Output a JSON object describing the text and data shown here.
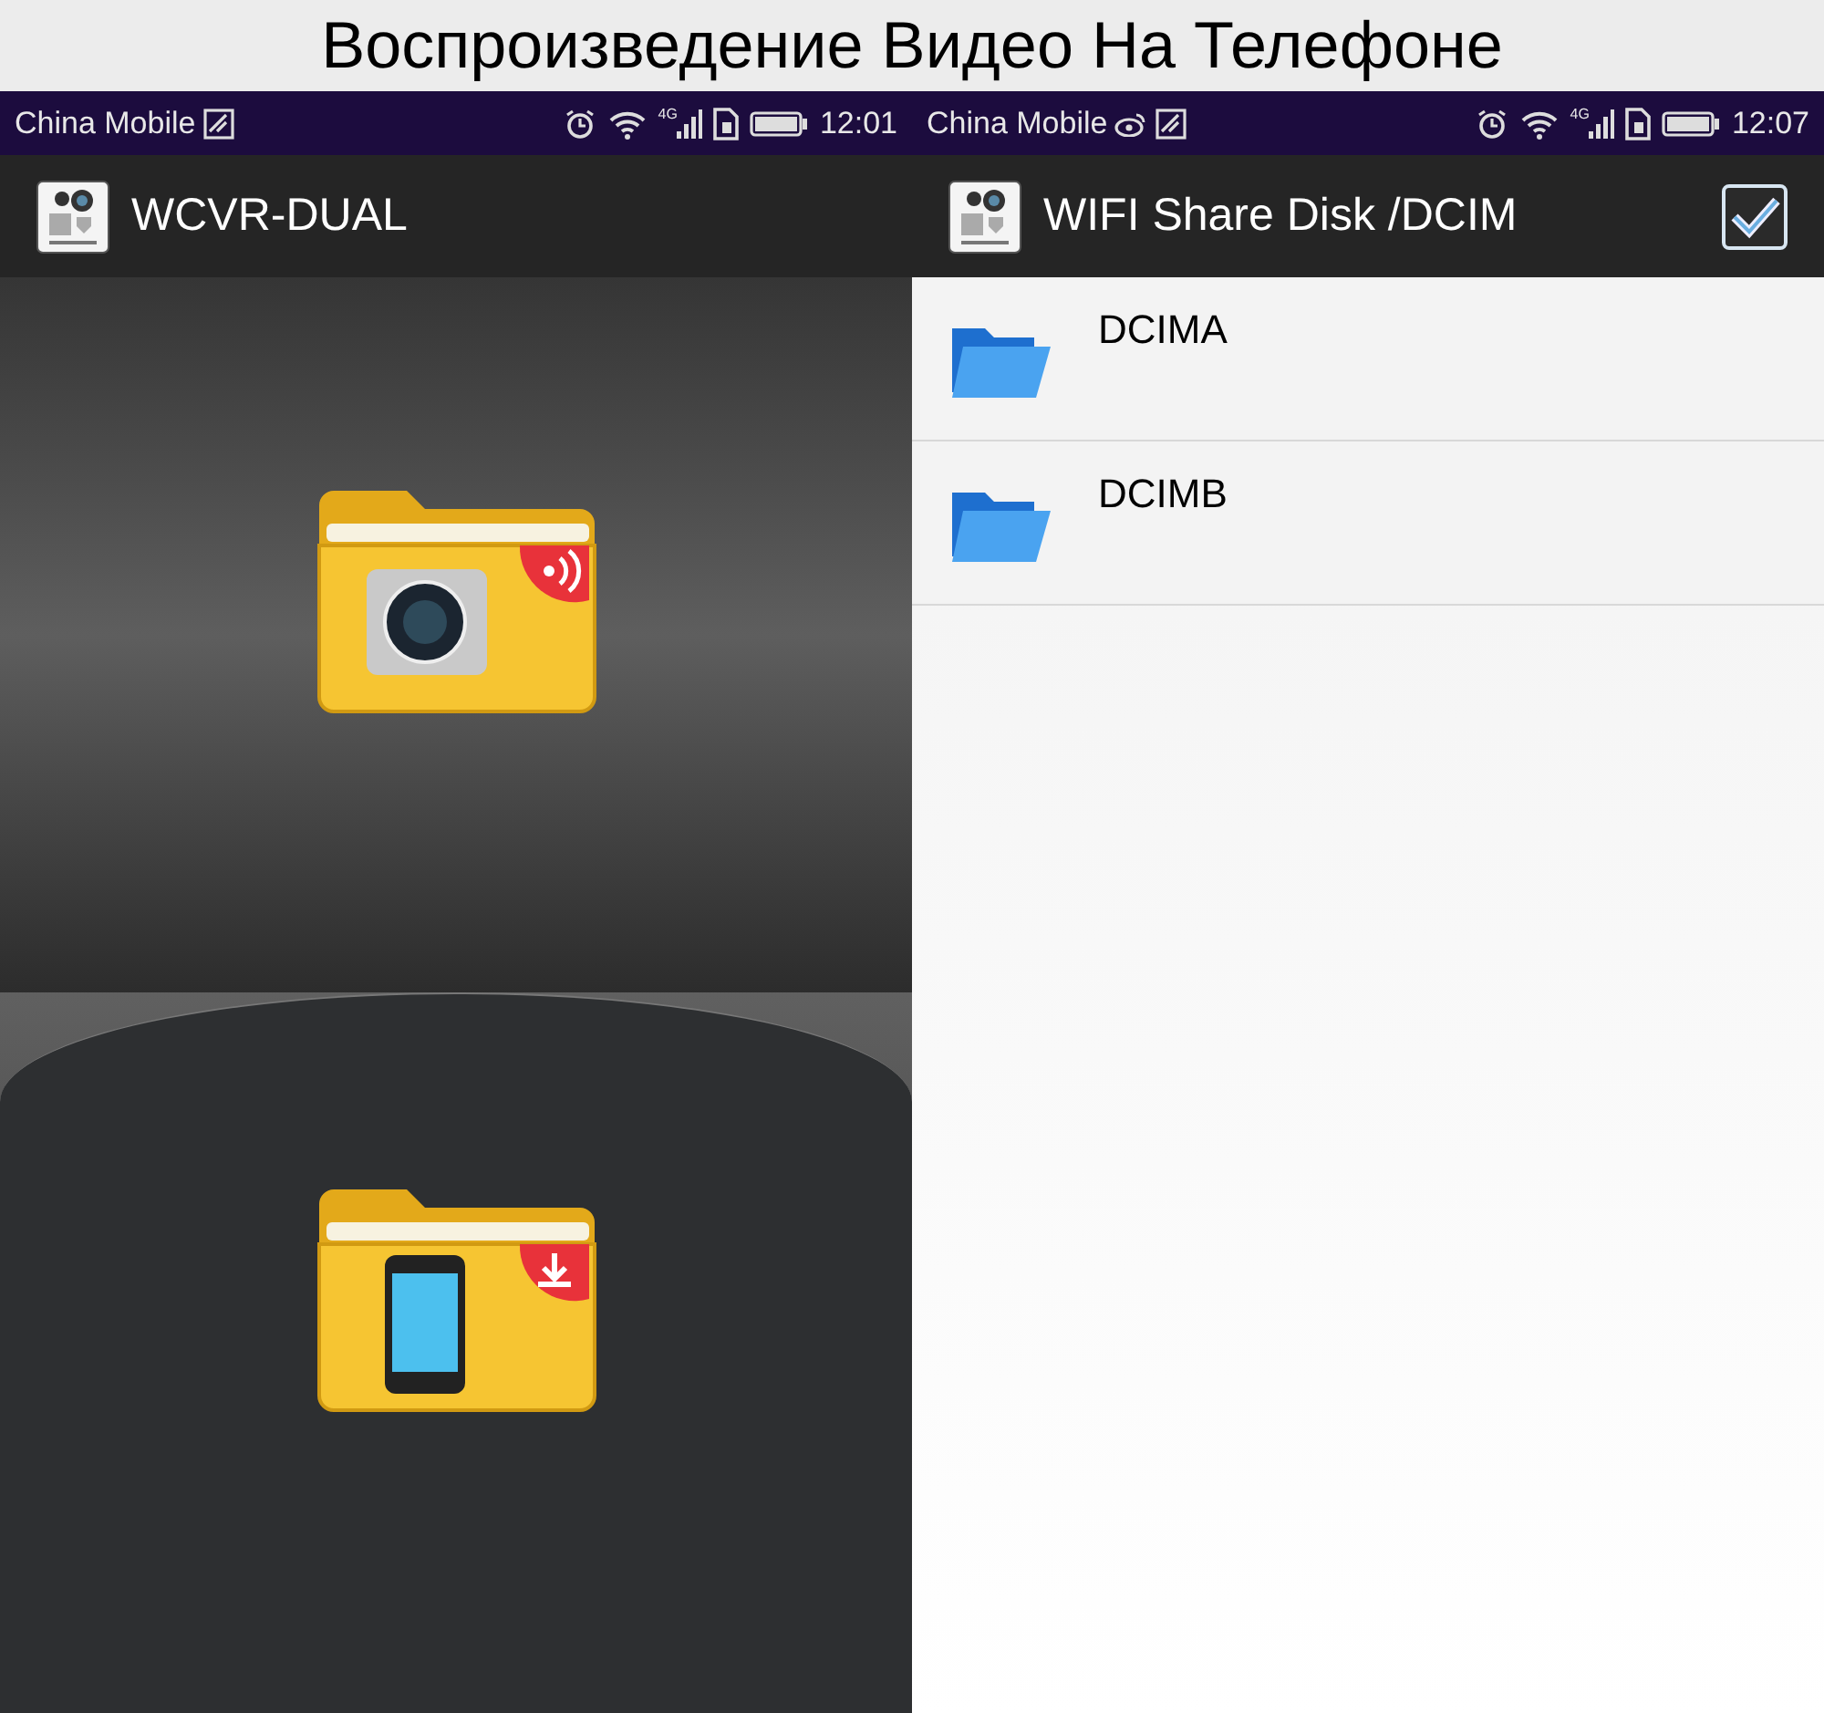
{
  "header": {
    "title": "Воспроизведение Видео На Телефоне"
  },
  "phones": [
    {
      "kind": "home",
      "status": {
        "carrier": "China Mobile",
        "notifications": [
          {
            "kind": "image"
          }
        ],
        "network": "4G",
        "time": "12:01"
      },
      "app_bar": {
        "title": "WCVR-DUAL"
      },
      "tiles": [
        {
          "kind": "camera-wifi"
        },
        {
          "kind": "phone-download"
        }
      ]
    },
    {
      "kind": "browser",
      "status": {
        "carrier": "China Mobile",
        "notifications": [
          {
            "kind": "weibo"
          },
          {
            "kind": "image"
          }
        ],
        "network": "4G",
        "time": "12:07"
      },
      "app_bar": {
        "title": "WIFI Share Disk /DCIM",
        "select_all": {
          "checked": true
        }
      },
      "folders": [
        {
          "name": "DCIMA"
        },
        {
          "name": "DCIMB"
        }
      ]
    }
  ]
}
